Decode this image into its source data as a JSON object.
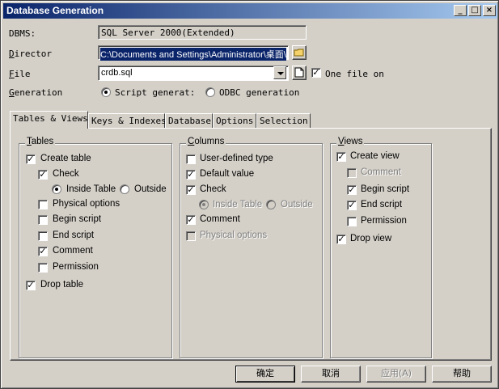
{
  "window": {
    "title": "Database Generation",
    "minimize_glyph": "_",
    "maximize_glyph": "□",
    "close_glyph": "×"
  },
  "form": {
    "dbms_label": "DBMS:",
    "dbms_value": "SQL Server 2000(Extended)",
    "director_label": "Director",
    "director_value": "C:\\Documents and Settings\\Administrator\\桌面\\",
    "file_label": "File",
    "file_value": "crdb.sql",
    "one_file_label": "One file on",
    "one_file_checked": true,
    "generation_label": "Generation",
    "generation_options": [
      {
        "label": "Script generat:",
        "selected": true
      },
      {
        "label": "ODBC generation",
        "selected": false
      }
    ]
  },
  "tabs": [
    {
      "label": "Tables & Views",
      "active": true
    },
    {
      "label": "Keys & Indexes",
      "active": false
    },
    {
      "label": "Database",
      "active": false
    },
    {
      "label": "Options",
      "active": false
    },
    {
      "label": "Selection",
      "active": false
    }
  ],
  "tables_group": {
    "title": "Tables",
    "create_table": "Create table",
    "check": "Check",
    "inside_table": "Inside Table",
    "outside": "Outside",
    "physical_options": "Physical options",
    "begin_script": "Begin script",
    "end_script": "End script",
    "comment": "Comment",
    "permission": "Permission",
    "drop_table": "Drop table"
  },
  "columns_group": {
    "title": "Columns",
    "user_defined_type": "User-defined type",
    "default_value": "Default value",
    "check": "Check",
    "inside_table": "Inside Table",
    "outside": "Outside",
    "comment": "Comment",
    "physical_options": "Physical options"
  },
  "views_group": {
    "title": "Views",
    "create_view": "Create view",
    "comment": "Comment",
    "begin_script": "Begin script",
    "end_script": "End script",
    "permission": "Permission",
    "drop_view": "Drop view"
  },
  "buttons": {
    "ok": "确定",
    "cancel": "取消",
    "apply": "应用(A)",
    "help": "帮助"
  },
  "checkmark": "✓"
}
